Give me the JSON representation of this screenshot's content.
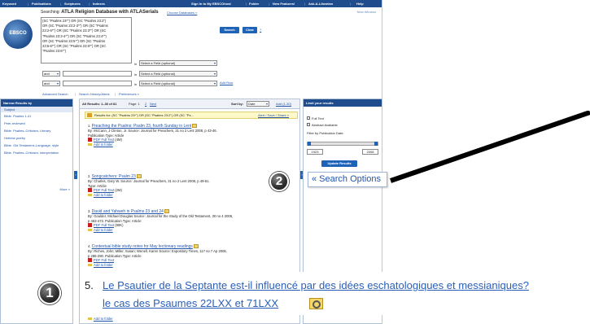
{
  "topnav": {
    "links": [
      "Keyword",
      "Publications",
      "Scriptures",
      "Indexes"
    ],
    "right_links": [
      "Sign In to My EBSCOhost",
      "Folder",
      "New Features!",
      "Ask-A-Librarian",
      "Help"
    ]
  },
  "logo": {
    "text": "EBSCO"
  },
  "search": {
    "searching_prefix": "Searching:",
    "database": "ATLA Religion Database with ATLASerials",
    "choose_databases": "Choose Databases »",
    "query_lines": [
      "(SC \"Psalms 23*\") OR (SC \"Psalms 23:2\")",
      "OR (SC \"Psalms 23:2-3*\") OR (SC \"Psalms",
      "23:2-6*\") OR (SC \"Psalms 23:3*\") OR (SC",
      "\"Psalms 23:3-4*\") OR (SC \"Psalms 23:4*\")",
      "OR (SC \"Psalms 23:5*\") OR (SC \"Psalms",
      "23:5-6*\") OR (SC \"Psalms 23:6*\") OR (SC",
      "\"Psalms 23:6*\")"
    ],
    "search_button": "Search",
    "clear_button": "Clear",
    "new_window": "New Window",
    "in_label": "in",
    "field_placeholder": "Select a Field (optional)",
    "bool_and": "and",
    "add_row": "Add Row",
    "advanced": "Advanced Search",
    "history": "Search History/Alerts",
    "preferences": "Preferences »"
  },
  "narrow": {
    "title": "Narrow Results by",
    "subheading": "Subject",
    "items": [
      "Bible. Psalms 1-41",
      "Peer-reviewed",
      "Bible. Psalms–Criticism, Literary",
      "Hebrew poetry",
      "Bible. Old Testament–Language, style",
      "Bible. Psalms–Criticism, interpretation"
    ],
    "more": "More »"
  },
  "results": {
    "header_left": "All Results: 1–30 of 81",
    "page_label": "Page: 1",
    "page_2": "2",
    "next": "Next",
    "sort_label": "Sort by:",
    "sort_value": "Date",
    "add_to_folder": "Add (1-30)",
    "bar_text": "Results for: (SC \"Psalms 23*\") OR (SC \"Psalms 23:2\") OR (SC \"Ps...",
    "bar_right": "Alert / Save / Share »",
    "items": [
      {
        "n": "1.",
        "title": "Preaching the Psalms: Psalm 23, fourth Sunday in Lent",
        "line1": "By: McCann, J Clinton, Jr.  Source: Journal for Preachers, 31 no 2 Lent 2008, p 43-46.",
        "line2": "Publication Type: Article",
        "pdf": "PDF Full Text",
        "pdf_size": "(4M)",
        "add": "Add to folder"
      },
      {
        "n": "2.",
        "title": "Songcatchers: Psalm 23",
        "line1": "By: Charles, Gary W.  Source: Journal for Preachers, 31 no 2 Lent 2008, p 49-51.",
        "line2": "Type: Article",
        "pdf": "PDF Full Text",
        "pdf_size": "(2M)",
        "add": "Add to folder"
      },
      {
        "n": "3.",
        "title": "David and Yahweh in Psalms 23 and 24",
        "line1": "By: Goulder, Michael Douglas  Source: Journal for the Study of the Old Testament, 30 no 4 2006,",
        "line2": "p 463-473.  Publication Type: Article",
        "pdf": "PDF Full Text",
        "pdf_size": "(90K)",
        "add": "Add to folder"
      },
      {
        "n": "4.",
        "title": "Contextual bible study notes for May lectionary readings",
        "line1": "By: Riches, John; Miller, Susan; Wenell, Karen  Source: Expository Times, 117 no 7 Ap 2006,",
        "line2": "p 286-290.  Publication Type: Article",
        "pdf": "PDF Full Text",
        "pdf_size": "",
        "add": "Add to folder"
      }
    ],
    "last_add": "Add to folder"
  },
  "limit": {
    "title": "Limit your results",
    "full_text": "Full Text",
    "abstract": "Abstract Available",
    "pubdate_label": "Filter by Publication Date:",
    "year_from": "1923",
    "year_to": "2008",
    "update": "Update Results"
  },
  "callouts": {
    "num1": "1",
    "num2": "2",
    "search_options": "« Search Options",
    "zoom_number": "5.",
    "zoom_line1": "Le Psautier de la Septante est-il influencé par des idées eschatologiques et messianiques?",
    "zoom_line2": "le cas des Psaumes 22LXX et 71LXX"
  }
}
